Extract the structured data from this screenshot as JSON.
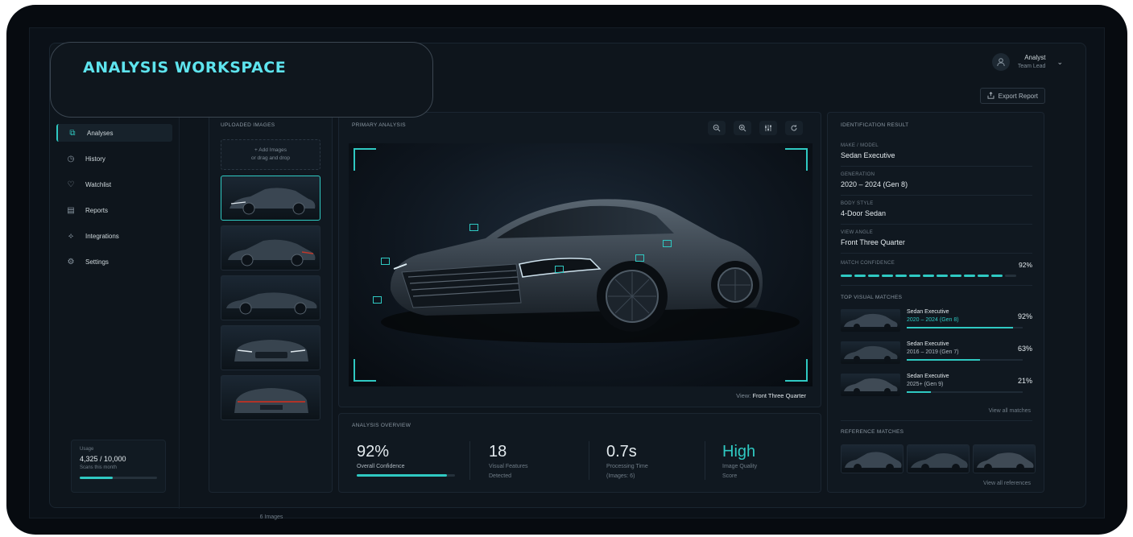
{
  "title": "ANALYSIS WORKSPACE",
  "user": {
    "name": "Analyst",
    "role": "Team Lead"
  },
  "export_label": "Export Report",
  "nav": [
    {
      "label": "Analyses"
    },
    {
      "label": "History"
    },
    {
      "label": "Watchlist"
    },
    {
      "label": "Reports"
    },
    {
      "label": "Integrations"
    },
    {
      "label": "Settings"
    }
  ],
  "usage": {
    "label": "Usage",
    "value": "4,325 / 10,000",
    "sub": "Scans this month",
    "fraction": 0.43
  },
  "uploads": {
    "label": "UPLOADED IMAGES",
    "add_label": "+ Add Images",
    "add_sub": "or drag and drop",
    "count": "6 Images"
  },
  "primary": {
    "label": "PRIMARY ANALYSIS",
    "view_prefix": "View:",
    "view_value": "Front Three Quarter"
  },
  "overview": {
    "label": "ANALYSIS OVERVIEW",
    "confidence": {
      "value": "92%",
      "label": "Overall Confidence",
      "fraction": 0.92
    },
    "features": {
      "value": "18",
      "label1": "Visual Features",
      "label2": "Detected"
    },
    "time": {
      "value": "0.7s",
      "label1": "Processing Time",
      "label2": "(Images: 6)"
    },
    "quality": {
      "value": "High",
      "label1": "Image Quality",
      "label2": "Score"
    }
  },
  "identification": {
    "label": "IDENTIFICATION RESULT",
    "make_label": "MAKE / MODEL",
    "make_value": "Sedan Executive",
    "gen_label": "GENERATION",
    "gen_value": "2020 – 2024 (Gen 8)",
    "body_label": "BODY STYLE",
    "body_value": "4-Door Sedan",
    "angle_label": "VIEW ANGLE",
    "angle_value": "Front Three Quarter",
    "conf_label": "MATCH CONFIDENCE",
    "conf_value": "92%",
    "conf_fraction": 0.92
  },
  "top_matches": {
    "label": "TOP VISUAL MATCHES",
    "items": [
      {
        "name": "Sedan Executive",
        "gen": "2020 – 2024 (Gen 8)",
        "pct": "92%",
        "fraction": 0.92
      },
      {
        "name": "Sedan Executive",
        "gen": "2016 – 2019 (Gen 7)",
        "pct": "63%",
        "fraction": 0.63
      },
      {
        "name": "Sedan Executive",
        "gen": "2025+ (Gen 9)",
        "pct": "21%",
        "fraction": 0.21
      }
    ],
    "view_all": "View all matches"
  },
  "references": {
    "label": "REFERENCE MATCHES",
    "view_all": "View all references"
  },
  "colors": {
    "accent": "#2fc9c2",
    "title": "#5ee4ee",
    "background": "#0e151c"
  },
  "icons": [
    "user-icon",
    "chevron-down-icon",
    "export-icon",
    "analyses-icon",
    "history-icon",
    "watchlist-icon",
    "reports-icon",
    "integrations-icon",
    "settings-icon",
    "zoom-out-icon",
    "zoom-in-icon",
    "adjust-icon",
    "reset-icon"
  ]
}
